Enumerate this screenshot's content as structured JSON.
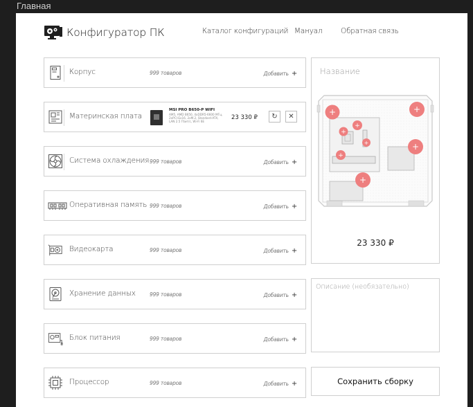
{
  "window": {
    "title": "Главная"
  },
  "header": {
    "logo_text": "Конфигуратор ПК",
    "nav": [
      {
        "label": "Каталог конфигураций"
      },
      {
        "label": "Мануал"
      },
      {
        "label": "Обратная связь"
      }
    ]
  },
  "components": [
    {
      "label": "Корпус",
      "count": "999 товаров",
      "add": "Добавить",
      "icon": "pc-case-icon"
    },
    {
      "label": "Материнская плата",
      "icon": "motherboard-icon",
      "selected": {
        "name": "MSI PRO B650-P WIFI",
        "specs": "AM5, AMD B650, 4xDDR5-6600 МГц, 2xPCI-Ex16, 2xM.2, Standard-ATX, LAN 2.5 Гбит/с, Wi-Fi 6E",
        "price": "23 330 ₽"
      }
    },
    {
      "label": "Система охлаждения",
      "count": "999 товаров",
      "add": "Добавить",
      "icon": "cooler-fan-icon"
    },
    {
      "label": "Оперативная память",
      "count": "999 товаров",
      "add": "Добавить",
      "icon": "ram-icon"
    },
    {
      "label": "Видеокарта",
      "count": "999 товаров",
      "add": "Добавить",
      "icon": "gpu-icon"
    },
    {
      "label": "Хранение данных",
      "count": "999 товаров",
      "add": "Добавить",
      "icon": "hdd-icon"
    },
    {
      "label": "Блок питания",
      "count": "999 товаров",
      "add": "Добавить",
      "icon": "psu-icon"
    },
    {
      "label": "Процессор",
      "count": "999 товаров",
      "add": "Добавить",
      "icon": "cpu-icon"
    }
  ],
  "build": {
    "name_placeholder": "Название",
    "total_price": "23 330 ₽",
    "description_placeholder": "Описание (необязательно)",
    "save_label": "Сохранить сборку"
  },
  "colors": {
    "accent": "#ee7f7f",
    "border": "#cfcfcf"
  }
}
